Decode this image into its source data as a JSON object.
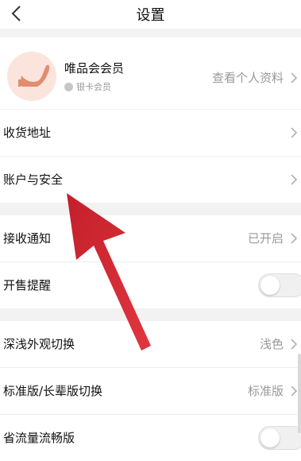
{
  "header": {
    "title": "设置"
  },
  "member": {
    "name": "唯品会会员",
    "level": "银卡会员",
    "profile_link": "查看个人资料"
  },
  "rows": {
    "address": {
      "label": "收货地址"
    },
    "account": {
      "label": "账户与安全"
    },
    "notify": {
      "label": "接收通知",
      "value": "已开启"
    },
    "presale": {
      "label": "开售提醒",
      "toggle_on": false
    },
    "theme": {
      "label": "深浅外观切换",
      "value": "浅色"
    },
    "elder": {
      "label": "标准版/长辈版切换",
      "value": "标准版"
    },
    "data_saver": {
      "label": "省流量流畅版",
      "toggle_on": false
    }
  },
  "colors": {
    "arrow": "#d32531",
    "avatar_bg": "#fbe4dc",
    "shoe": "#e08d70"
  },
  "icons": [
    "chevron-left-icon",
    "chevron-right-icon",
    "high-heel-shoe-icon",
    "silver-badge-icon",
    "red-arrow-annotation"
  ]
}
